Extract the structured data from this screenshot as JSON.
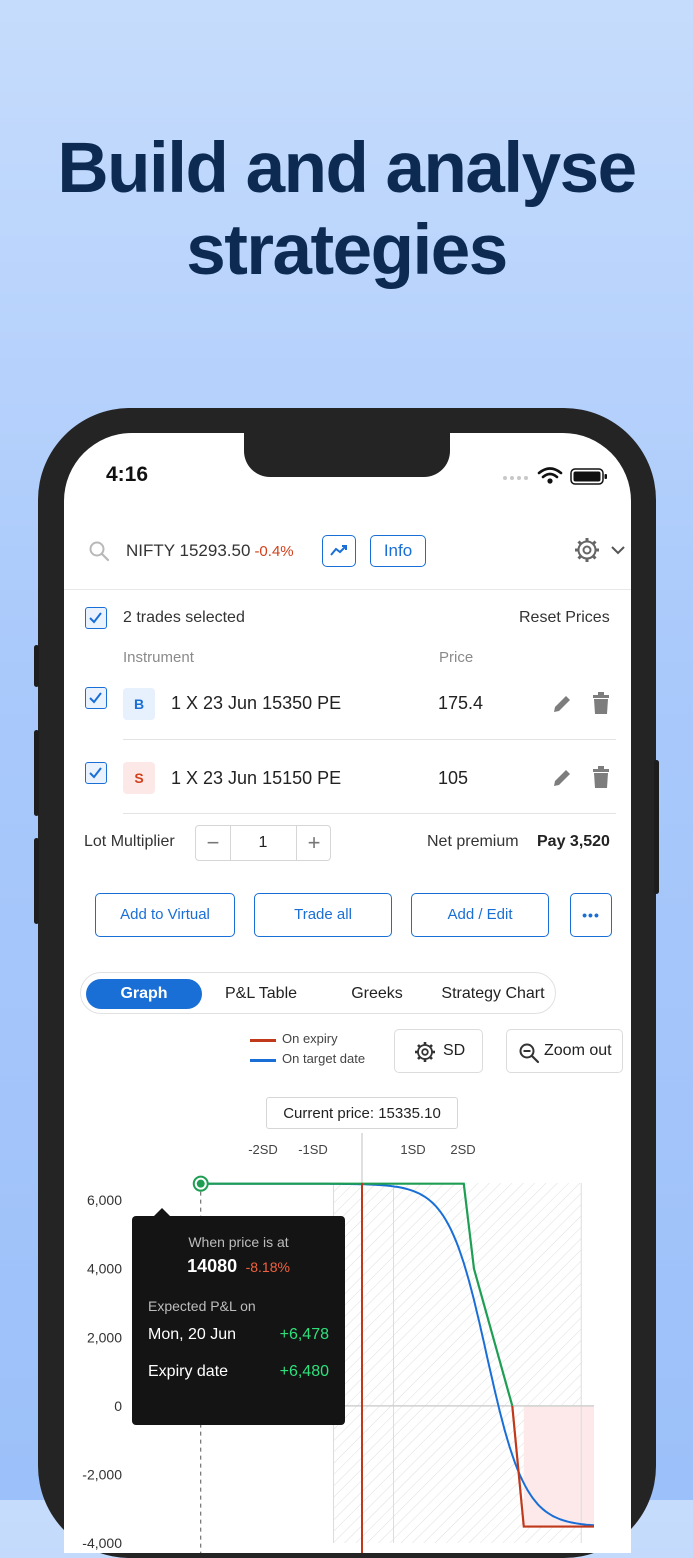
{
  "headline": {
    "line1": "Build and analyse",
    "line2": "strategies"
  },
  "status_bar": {
    "time": "4:16"
  },
  "header": {
    "symbol": "NIFTY 15293.50",
    "change": "-0.4%",
    "info_label": "Info",
    "icons": [
      "search-icon",
      "trend-chart-icon",
      "gear-icon",
      "chevron-down-icon"
    ]
  },
  "trades": {
    "selected_label": "2 trades selected",
    "reset_label": "Reset Prices",
    "col_instrument": "Instrument",
    "col_price": "Price",
    "rows": [
      {
        "side": "B",
        "instrument": "1 X 23 Jun 15350 PE",
        "price": "175.4",
        "side_color": "#1a6fd6",
        "side_bg": "#e7f0fd"
      },
      {
        "side": "S",
        "instrument": "1 X 23 Jun 15150 PE",
        "price": "105",
        "side_color": "#d2401c",
        "side_bg": "#fde8e8"
      }
    ]
  },
  "lot": {
    "label": "Lot Multiplier",
    "minus": "−",
    "value": "1",
    "plus": "+",
    "net_label": "Net premium",
    "net_value": "Pay 3,520"
  },
  "actions": {
    "add_virtual": "Add to Virtual",
    "trade_all": "Trade all",
    "add_edit": "Add / Edit",
    "more": "•••"
  },
  "tabs": [
    {
      "label": "Graph",
      "active": true
    },
    {
      "label": "P&L Table",
      "active": false
    },
    {
      "label": "Greeks",
      "active": false
    },
    {
      "label": "Strategy Chart",
      "active": false
    }
  ],
  "legend": {
    "expiry": "On expiry",
    "target": "On target date",
    "expiry_color": "#c0391b",
    "target_color": "#1a6fd6",
    "profit_color": "#1e9e53"
  },
  "chart_controls": {
    "sd_label": "SD",
    "zoom_label": "Zoom out"
  },
  "current_price_label": "Current price: 15335.10",
  "sd_marks": [
    "-2SD",
    "-1SD",
    "1SD",
    "2SD"
  ],
  "chart_data": {
    "type": "line",
    "y_ticks": [
      "6,000",
      "4,000",
      "2,000",
      "0",
      "-2,000",
      "-4,000"
    ],
    "ylim": [
      -4000,
      6500
    ],
    "series": [
      {
        "name": "On expiry",
        "x": [
          14080,
          15150,
          15350,
          15600
        ],
        "y": [
          6480,
          6480,
          -3520,
          -3520
        ]
      },
      {
        "name": "On target date",
        "x": [
          14080,
          14700,
          15150,
          15350,
          15600
        ],
        "y": [
          6478,
          5000,
          2500,
          -1500,
          -3500
        ]
      }
    ]
  },
  "tooltip": {
    "title": "When price is at",
    "price": "14080",
    "pct": "-8.18%",
    "expected_label": "Expected P&L on",
    "date_label": "Mon, 20 Jun",
    "date_value": "+6,478",
    "expiry_label": "Expiry date",
    "expiry_value": "+6,480"
  }
}
